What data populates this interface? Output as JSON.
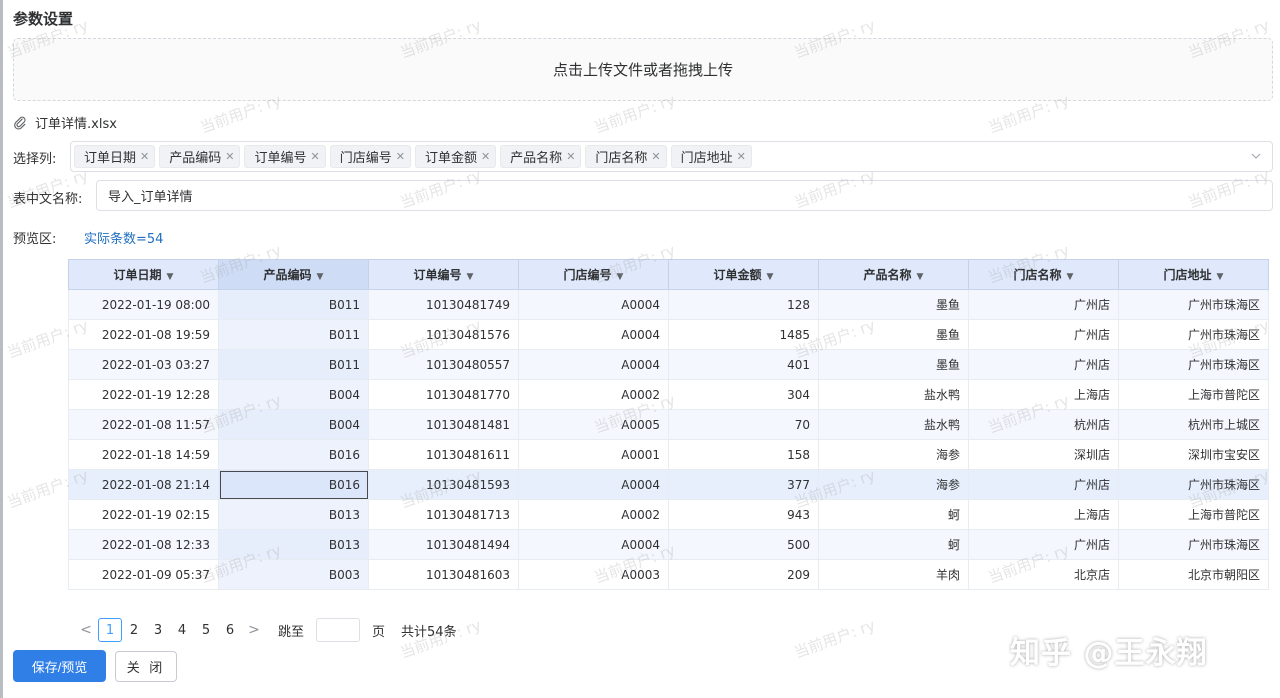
{
  "page": {
    "title": "参数设置"
  },
  "upload": {
    "hint": "点击上传文件或者拖拽上传",
    "file_name": "订单详情.xlsx"
  },
  "form": {
    "columns_label": "选择列:",
    "selected_columns": [
      "订单日期",
      "产品编码",
      "订单编号",
      "门店编号",
      "订单金额",
      "产品名称",
      "门店名称",
      "门店地址"
    ],
    "table_name_label": "表中文名称:",
    "table_name_value": "导入_订单详情",
    "preview_label": "预览区:",
    "count_text": "实际条数=54"
  },
  "table": {
    "headers": [
      "订单日期",
      "产品编码",
      "订单编号",
      "门店编号",
      "订单金额",
      "产品名称",
      "门店名称",
      "门店地址"
    ],
    "rows": [
      [
        "2022-01-19 08:00",
        "B011",
        "10130481749",
        "A0004",
        "128",
        "墨鱼",
        "广州店",
        "广州市珠海区"
      ],
      [
        "2022-01-08 19:59",
        "B011",
        "10130481576",
        "A0004",
        "1485",
        "墨鱼",
        "广州店",
        "广州市珠海区"
      ],
      [
        "2022-01-03 03:27",
        "B011",
        "10130480557",
        "A0004",
        "401",
        "墨鱼",
        "广州店",
        "广州市珠海区"
      ],
      [
        "2022-01-19 12:28",
        "B004",
        "10130481770",
        "A0002",
        "304",
        "盐水鸭",
        "上海店",
        "上海市普陀区"
      ],
      [
        "2022-01-08 11:57",
        "B004",
        "10130481481",
        "A0005",
        "70",
        "盐水鸭",
        "杭州店",
        "杭州市上城区"
      ],
      [
        "2022-01-18 14:59",
        "B016",
        "10130481611",
        "A0001",
        "158",
        "海参",
        "深圳店",
        "深圳市宝安区"
      ],
      [
        "2022-01-08 21:14",
        "B016",
        "10130481593",
        "A0004",
        "377",
        "海参",
        "广州店",
        "广州市珠海区"
      ],
      [
        "2022-01-19 02:15",
        "B013",
        "10130481713",
        "A0002",
        "943",
        "蚵",
        "上海店",
        "上海市普陀区"
      ],
      [
        "2022-01-08 12:33",
        "B013",
        "10130481494",
        "A0004",
        "500",
        "蚵",
        "广州店",
        "广州市珠海区"
      ],
      [
        "2022-01-09 05:37",
        "B003",
        "10130481603",
        "A0003",
        "209",
        "羊肉",
        "北京店",
        "北京市朝阳区"
      ]
    ]
  },
  "pagination": {
    "prev": "<",
    "next": ">",
    "pages": [
      "1",
      "2",
      "3",
      "4",
      "5",
      "6"
    ],
    "current": "1",
    "jump_label": "跳至",
    "page_unit": "页",
    "total_text": "共计54条"
  },
  "buttons": {
    "save_preview": "保存/预览",
    "close": "关 闭"
  },
  "watermark": {
    "text": "当前用户: ry"
  },
  "brand_watermark": "知乎 @王永翔",
  "icons": {
    "attachment": "paperclip-icon",
    "tag_close": "close-icon",
    "dropdown": "chevron-down-icon",
    "sort": "sort-caret-icon"
  },
  "colors": {
    "primary": "#2f7fe7",
    "header_bg": "#dfe9fb",
    "link": "#1f6fc1"
  }
}
